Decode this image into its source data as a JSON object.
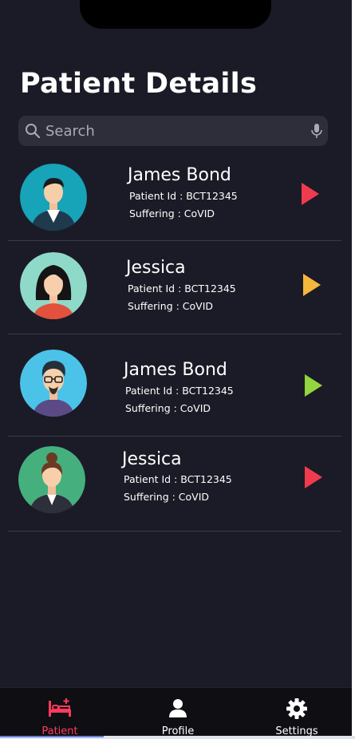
{
  "page": {
    "title": "Patient Details"
  },
  "search": {
    "placeholder": "Search"
  },
  "patients": [
    {
      "name": "James Bond",
      "patient_id": "Patient Id : BCT12345",
      "suffering": "Suffering : CoVID",
      "arrow_color": "#ef3b4d",
      "avatar": "man-suit"
    },
    {
      "name": "Jessica",
      "patient_id": "Patient Id : BCT12345",
      "suffering": "Suffering : CoVID",
      "arrow_color": "#f4b73c",
      "avatar": "woman-long-hair"
    },
    {
      "name": "James Bond",
      "patient_id": "Patient Id : BCT12345",
      "suffering": "Suffering : CoVID",
      "arrow_color": "#93d53f",
      "avatar": "man-glasses"
    },
    {
      "name": "Jessica",
      "patient_id": "Patient Id : BCT12345",
      "suffering": "Suffering : CoVID",
      "arrow_color": "#ef3b4d",
      "avatar": "woman-bun"
    }
  ],
  "nav": {
    "items": [
      {
        "label": "Patient",
        "icon": "hospital-bed-icon",
        "active": true
      },
      {
        "label": "Profile",
        "icon": "person-icon",
        "active": false
      },
      {
        "label": "Settings",
        "icon": "gear-icon",
        "active": false
      }
    ]
  },
  "colors": {
    "background": "#1b1b27",
    "accent": "#ff3b5c",
    "search_bg": "#2d2e39"
  }
}
